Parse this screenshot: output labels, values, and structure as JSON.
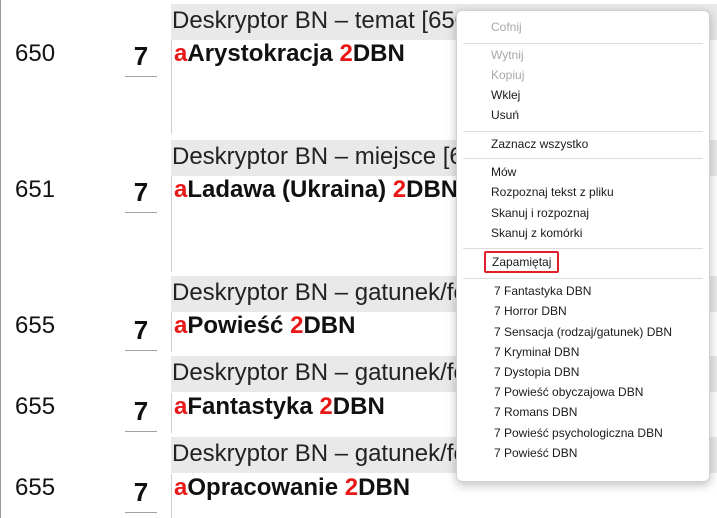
{
  "records": [
    {
      "tag": "650",
      "ind": "7",
      "label": "Deskryptor BN – temat [650]",
      "sub_a": "a",
      "val": "Arystokracja ",
      "sub_2": "2",
      "src": "DBN"
    },
    {
      "tag": "651",
      "ind": "7",
      "label": "Deskryptor BN – miejsce [651]",
      "sub_a": "a",
      "val": "Ladawa (Ukraina) ",
      "sub_2": "2",
      "src": "DBN"
    },
    {
      "tag": "655",
      "ind": "7",
      "label": "Deskryptor BN – gatunek/forma [655]",
      "sub_a": "a",
      "val": "Powieść ",
      "sub_2": "2",
      "src": "DBN"
    },
    {
      "tag": "655",
      "ind": "7",
      "label": "Deskryptor BN – gatunek/forma [655]",
      "sub_a": "a",
      "val": "Fantastyka ",
      "sub_2": "2",
      "src": "DBN"
    },
    {
      "tag": "655",
      "ind": "7",
      "label": "Deskryptor BN – gatunek/forma [655]",
      "sub_a": "a",
      "val": "Opracowanie ",
      "sub_2": "2",
      "src": "DBN"
    }
  ],
  "menu": {
    "undo": "Cofnij",
    "cut": "Wytnij",
    "copy": "Kopiuj",
    "paste": "Wklej",
    "delete": "Usuń",
    "select_all": "Zaznacz wszystko",
    "speak": "Mów",
    "ocr_file": "Rozpoznaj tekst z pliku",
    "scan_ocr": "Skanuj i rozpoznaj",
    "scan_cell": "Skanuj z komórki",
    "remember": "Zapamiętaj",
    "suggestions": [
      "7 Fantastyka DBN",
      "7 Horror DBN",
      "7 Sensacja (rodzaj/gatunek) DBN",
      "7 Kryminał DBN",
      "7 Dystopia DBN",
      "7 Powieść obyczajowa DBN",
      "7 Romans DBN",
      "7 Powieść psychologiczna DBN",
      "7 Powieść DBN"
    ]
  },
  "colors": {
    "subfield_code": "#e81818",
    "highlight_border": "#e0202a"
  }
}
